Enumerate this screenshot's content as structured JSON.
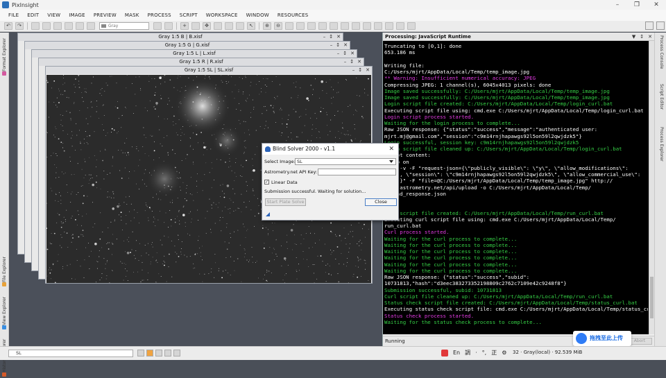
{
  "app": {
    "title": "PixInsight"
  },
  "menu": [
    "FILE",
    "EDIT",
    "VIEW",
    "IMAGE",
    "PREVIEW",
    "MASK",
    "PROCESS",
    "SCRIPT",
    "WORKSPACE",
    "WINDOW",
    "RESOURCES"
  ],
  "toolbar": {
    "channel_select": "Gray"
  },
  "left_dock_tabs": [
    "Format Explorer",
    "File Explorer",
    "View Explorer",
    "History Explorer"
  ],
  "right_dock_tabs": [
    "Process Console",
    "Script Editor",
    "Process Explorer"
  ],
  "image_windows": [
    "Gray 1:5 B | B.xisf",
    "Gray 1:5 G | G.xisf",
    "Gray 1:5 L | L.xisf",
    "Gray 1:5 R | R.xisf",
    "Gray 1:5 SL | SL.xisf"
  ],
  "console": {
    "title": "Processing: JavaScript Runtime",
    "status": "Running",
    "abort_label": "Abort",
    "colors": {
      "white": "#ffffff",
      "green": "#36d046",
      "magenta": "#e33be3"
    },
    "lines": [
      {
        "t": "Truncating to [0,1]: done",
        "c": "white"
      },
      {
        "t": "653.186 ms",
        "c": "white"
      },
      {
        "t": "",
        "c": "white"
      },
      {
        "t": "Writing file:",
        "c": "white"
      },
      {
        "t": "C:/Users/mjrt/AppData/Local/Temp/temp_image.jpg",
        "c": "white"
      },
      {
        "t": "** Warning: Insufficient numerical accuracy: JPEG",
        "c": "magenta"
      },
      {
        "t": "Compressing JPEG: 1 channel(s), 6045x4013 pixels: done",
        "c": "white"
      },
      {
        "t": "Image saved successfully: C:/Users/mjrt/AppData/Local/Temp/temp_image.jpg",
        "c": "green"
      },
      {
        "t": "Image saved successfully: C:/Users/mjrt/AppData/Local/Temp/temp_image.jpg",
        "c": "green"
      },
      {
        "t": "Login script file created: C:/Users/mjrt/AppData/Local/Temp/login_curl.bat",
        "c": "green"
      },
      {
        "t": "Executing script file using: cmd.exe C:/Users/mjrt/AppData/Local/Temp/login_curl.bat",
        "c": "white"
      },
      {
        "t": "Login script process started.",
        "c": "magenta"
      },
      {
        "t": "Waiting for the login process to complete...",
        "c": "green"
      },
      {
        "t": "Raw JSON response: {\"status\":\"success\",\"message\":\"authenticated user:",
        "c": "white"
      },
      {
        "t": "mjrt.mj@gmail.com\",\"session\":\"c9m14rnjhapawgs92l5on59l2qwjdzk5\"}",
        "c": "white"
      },
      {
        "t": "Login successful, session key: c9m14rnjhapawgs92l5on59l2qwjdzk5",
        "c": "green"
      },
      {
        "t": "Login script file cleaned up: C:/Users/mjrt/AppData/Local/Temp/login_curl.bat",
        "c": "green"
      },
      {
        "t": "Script content:",
        "c": "white"
      },
      {
        "t": "@echo on",
        "c": "white"
      },
      {
        "t": "curl -v -F \"request-json={\\\"publicly_visible\\\": \\\"y\\\", \\\"allow_modifications\\\":",
        "c": "white"
      },
      {
        "t": "\\\"d\\\", \\\"session\\\": \\\"c9m14rnjhapawgs92l5on59l2qwjdzk5\\\", \\\"allow_commercial_use\\\":",
        "c": "white"
      },
      {
        "t": "\\\"d\\\"}\" -F \"file=@C:/Users/mjrt/AppData/Local/Temp/temp_image.jpg\" http://",
        "c": "white"
      },
      {
        "t": "nova.astrometry.net/api/upload -o C:/Users/mjrt/AppData/Local/Temp/",
        "c": "white"
      },
      {
        "t": "upload_response.json",
        "c": "white"
      },
      {
        "t": "",
        "c": "white"
      },
      {
        "t": "",
        "c": "white"
      },
      {
        "t": "Curl script file created: C:/Users/mjrt/AppData/Local/Temp/run_curl.bat",
        "c": "green"
      },
      {
        "t": "Executing curl script file using: cmd.exe C:/Users/mjrt/AppData/Local/Temp/",
        "c": "white"
      },
      {
        "t": "run_curl.bat",
        "c": "white"
      },
      {
        "t": "Curl process started.",
        "c": "magenta"
      },
      {
        "t": "Waiting for the curl process to complete...",
        "c": "green"
      },
      {
        "t": "Waiting for the curl process to complete...",
        "c": "green"
      },
      {
        "t": "Waiting for the curl process to complete...",
        "c": "green"
      },
      {
        "t": "Waiting for the curl process to complete...",
        "c": "green"
      },
      {
        "t": "Waiting for the curl process to complete...",
        "c": "green"
      },
      {
        "t": "Waiting for the curl process to complete...",
        "c": "green"
      },
      {
        "t": "Raw JSON response: {\"status\":\"success\",\"subid\":",
        "c": "white"
      },
      {
        "t": "10731813,\"hash\":\"d3eec383273352198809c2762c7109e42c9248f8\"}",
        "c": "white"
      },
      {
        "t": "Submission successful, subid: 10731813",
        "c": "green"
      },
      {
        "t": "Curl script file cleaned up: C:/Users/mjrt/AppData/Local/Temp/run_curl.bat",
        "c": "green"
      },
      {
        "t": "Status check script file created: C:/Users/mjrt/AppData/Local/Temp/status_curl.bat",
        "c": "green"
      },
      {
        "t": "Executing status check script file: cmd.exe C:/Users/mjrt/AppData/Local/Temp/status_curl.bat",
        "c": "white"
      },
      {
        "t": "Status check process started.",
        "c": "magenta"
      },
      {
        "t": "Waiting for the status check process to complete...",
        "c": "green"
      }
    ]
  },
  "dialog": {
    "title": "Blind Solver 2000 - v1.1",
    "select_image_label": "Select Image:",
    "select_image_value": "SL",
    "api_key_label": "Astrometry.net API Key:",
    "api_key_value": "",
    "linear_data_label": "Linear Data",
    "linear_data_checked": true,
    "status_text": "Submission successful. Waiting for solution...",
    "start_button": "Start Plate Solve",
    "close_button": "Close"
  },
  "status_bar": {
    "view_select": "SL",
    "readout": "32 · Gray(local) · 92.539 MiB",
    "ime": [
      "En",
      "調",
      "·",
      "°,",
      "正"
    ]
  },
  "cloud_badge": {
    "label": "拖拽至此上传"
  }
}
